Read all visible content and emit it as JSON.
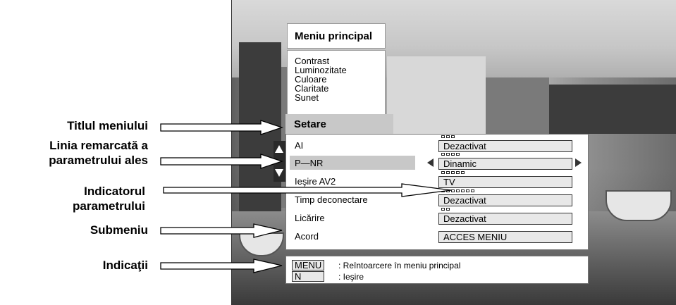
{
  "main_menu": {
    "title": "Meniu principal",
    "items": [
      "Contrast",
      "Luminozitate",
      "Culoare",
      "Claritate",
      "Sunet"
    ],
    "selected": "Setare"
  },
  "submenu": {
    "rows": [
      {
        "label": "AI",
        "value": "Dezactivat",
        "indicator_count": 3,
        "highlighted": false
      },
      {
        "label": "P—NR",
        "value": "Dinamic",
        "indicator_count": 4,
        "highlighted": true
      },
      {
        "label": "Ieşire AV2",
        "value": "TV",
        "indicator_count": 5,
        "highlighted": false
      },
      {
        "label": "Timp deconectare",
        "value": "Dezactivat",
        "indicator_count": 7,
        "highlighted": false
      },
      {
        "label": "Licărire",
        "value": "Dezactivat",
        "indicator_count": 2,
        "highlighted": false
      },
      {
        "label": "Acord",
        "value": "ACCES MENIU",
        "indicator_count": 0,
        "highlighted": false
      }
    ]
  },
  "hints": [
    {
      "key": "MENU",
      "text": ": Reîntoarcere în meniu principal"
    },
    {
      "key": "N",
      "text": ": Ieşire"
    }
  ],
  "callouts": {
    "titlu": "Titlul meniului",
    "linia_1": "Linia remarcată a",
    "linia_2": "parametrului ales",
    "indicator_1": "Indicatorul",
    "indicator_2": "parametrului",
    "submeniu": "Submeniu",
    "indicatii": "Indicaţii"
  }
}
